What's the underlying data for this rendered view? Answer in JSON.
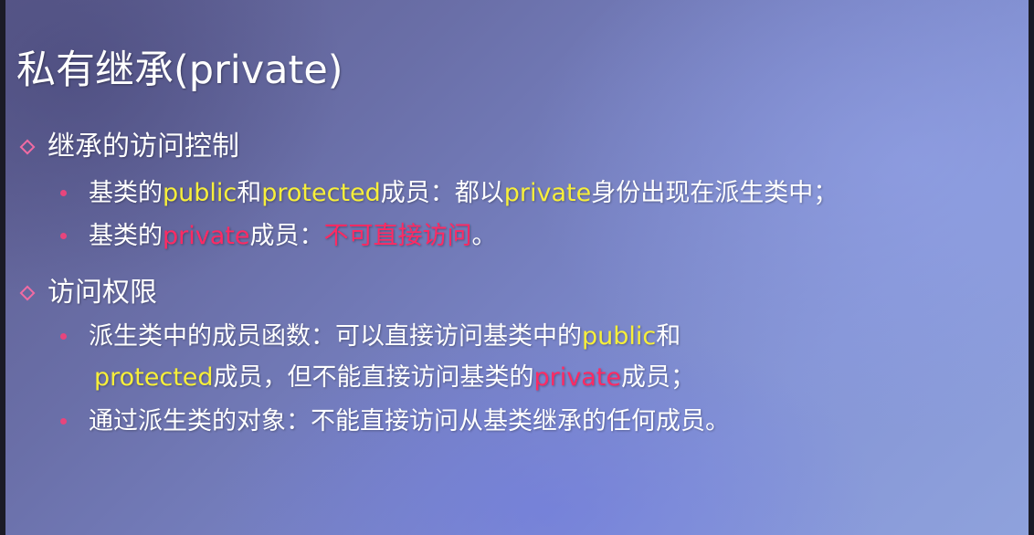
{
  "title": "私有继承(private)",
  "sections": [
    {
      "heading": "继承的访问控制",
      "bullets": [
        {
          "p1": "基类的",
          "p2": "public",
          "p3": "和",
          "p4": "protected",
          "p5": "成员：都以",
          "p6": "private",
          "p7": "身份出现在派生类中；"
        },
        {
          "p1": "基类的",
          "p2": "private",
          "p3": "成员：",
          "p4": "不可直接访问",
          "p5": "。"
        }
      ]
    },
    {
      "heading": "访问权限",
      "bullets": [
        {
          "p1": "派生类中的成员函数：可以直接访问基类中的",
          "p2": "public",
          "p3": "和",
          "c1": "protected",
          "c2": "成员，但不能直接访问基类的",
          "c3": "private",
          "c4": "成员；"
        },
        {
          "p1": "通过派生类的对象：不能直接访问从基类继承的任何成员。"
        }
      ]
    }
  ],
  "colors": {
    "highlight_yellow": "#f7ef3a",
    "highlight_red": "#ff2a63",
    "bullet_pink": "#e8457c"
  }
}
